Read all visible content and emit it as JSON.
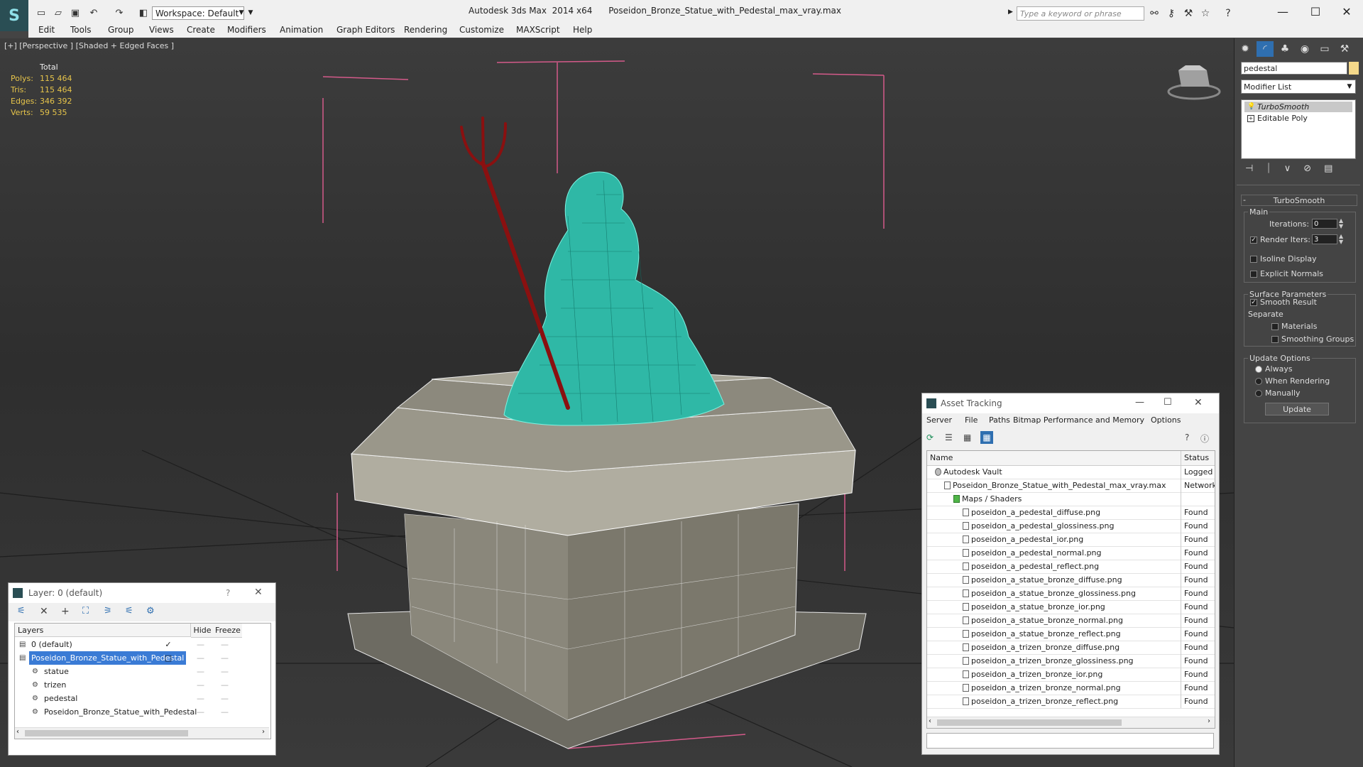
{
  "app": {
    "title": "Autodesk 3ds Max  2014 x64      Poseidon_Bronze_Statue_with_Pedestal_max_vray.max",
    "workspace": "Workspace: Default",
    "search_placeholder": "Type a keyword or phrase"
  },
  "menu": [
    "Edit",
    "Tools",
    "Group",
    "Views",
    "Create",
    "Modifiers",
    "Animation",
    "Graph Editors",
    "Rendering",
    "Customize",
    "MAXScript",
    "Help"
  ],
  "viewport": {
    "label": "[+] [Perspective ] [Shaded + Edged Faces ]",
    "stats": {
      "header": "Total",
      "rows": [
        {
          "label": "Polys:",
          "value": "115 464"
        },
        {
          "label": "Tris:",
          "value": "115 464"
        },
        {
          "label": "Edges:",
          "value": "346 392"
        },
        {
          "label": "Verts:",
          "value": "59 535"
        }
      ]
    }
  },
  "command_panel": {
    "object_name": "pedestal",
    "object_color": "#f4d88a",
    "modifier_list": "Modifier List",
    "stack": [
      "TurboSmooth",
      "Editable Poly"
    ],
    "rollout_title": "TurboSmooth",
    "main_group": "Main",
    "iterations_label": "Iterations:",
    "iterations_value": "0",
    "render_iters_label": "Render Iters:",
    "render_iters_value": "3",
    "render_iters_checked": true,
    "isoline_display": "Isoline Display",
    "explicit_normals": "Explicit Normals",
    "surface_parameters": "Surface Parameters",
    "smooth_result": "Smooth Result",
    "separate": "Separate",
    "materials": "Materials",
    "smoothing_groups": "Smoothing Groups",
    "update_options": "Update Options",
    "always": "Always",
    "when_rendering": "When Rendering",
    "manually": "Manually",
    "update_button": "Update"
  },
  "layer_dialog": {
    "title": "Layer: 0 (default)",
    "help": "?",
    "col_layers": "Layers",
    "col_hide": "Hide",
    "col_freeze": "Freeze",
    "rows": [
      {
        "name": "0 (default)",
        "indent": 0,
        "selected": false,
        "checked": true
      },
      {
        "name": "Poseidon_Bronze_Statue_with_Pedestal",
        "indent": 0,
        "selected": true,
        "checked": false
      },
      {
        "name": "statue",
        "indent": 1,
        "selected": false,
        "checked": false
      },
      {
        "name": "trizen",
        "indent": 1,
        "selected": false,
        "checked": false
      },
      {
        "name": "pedestal",
        "indent": 1,
        "selected": false,
        "checked": false
      },
      {
        "name": "Poseidon_Bronze_Statue_with_Pedestal",
        "indent": 1,
        "selected": false,
        "checked": false
      }
    ]
  },
  "asset_tracking": {
    "title": "Asset Tracking",
    "menu": [
      "Server",
      "File",
      "Paths",
      "Bitmap Performance and Memory",
      "Options"
    ],
    "col_name": "Name",
    "col_status": "Status",
    "rows": [
      {
        "name": "Autodesk Vault",
        "status": "Logged O",
        "indent": 1
      },
      {
        "name": "Poseidon_Bronze_Statue_with_Pedestal_max_vray.max",
        "status": "Network",
        "indent": 2
      },
      {
        "name": "Maps / Shaders",
        "status": "",
        "indent": 3
      },
      {
        "name": "poseidon_a_pedestal_diffuse.png",
        "status": "Found",
        "indent": 4
      },
      {
        "name": "poseidon_a_pedestal_glossiness.png",
        "status": "Found",
        "indent": 4
      },
      {
        "name": "poseidon_a_pedestal_ior.png",
        "status": "Found",
        "indent": 4
      },
      {
        "name": "poseidon_a_pedestal_normal.png",
        "status": "Found",
        "indent": 4
      },
      {
        "name": "poseidon_a_pedestal_reflect.png",
        "status": "Found",
        "indent": 4
      },
      {
        "name": "poseidon_a_statue_bronze_diffuse.png",
        "status": "Found",
        "indent": 4
      },
      {
        "name": "poseidon_a_statue_bronze_glossiness.png",
        "status": "Found",
        "indent": 4
      },
      {
        "name": "poseidon_a_statue_bronze_ior.png",
        "status": "Found",
        "indent": 4
      },
      {
        "name": "poseidon_a_statue_bronze_normal.png",
        "status": "Found",
        "indent": 4
      },
      {
        "name": "poseidon_a_statue_bronze_reflect.png",
        "status": "Found",
        "indent": 4
      },
      {
        "name": "poseidon_a_trizen_bronze_diffuse.png",
        "status": "Found",
        "indent": 4
      },
      {
        "name": "poseidon_a_trizen_bronze_glossiness.png",
        "status": "Found",
        "indent": 4
      },
      {
        "name": "poseidon_a_trizen_bronze_ior.png",
        "status": "Found",
        "indent": 4
      },
      {
        "name": "poseidon_a_trizen_bronze_normal.png",
        "status": "Found",
        "indent": 4
      },
      {
        "name": "poseidon_a_trizen_bronze_reflect.png",
        "status": "Found",
        "indent": 4
      }
    ]
  },
  "colors": {
    "selection": "#3a7bd5",
    "stat_yellow": "#e6c44a",
    "statue_wire": "#3fd9c0",
    "trident": "#8a1010"
  }
}
